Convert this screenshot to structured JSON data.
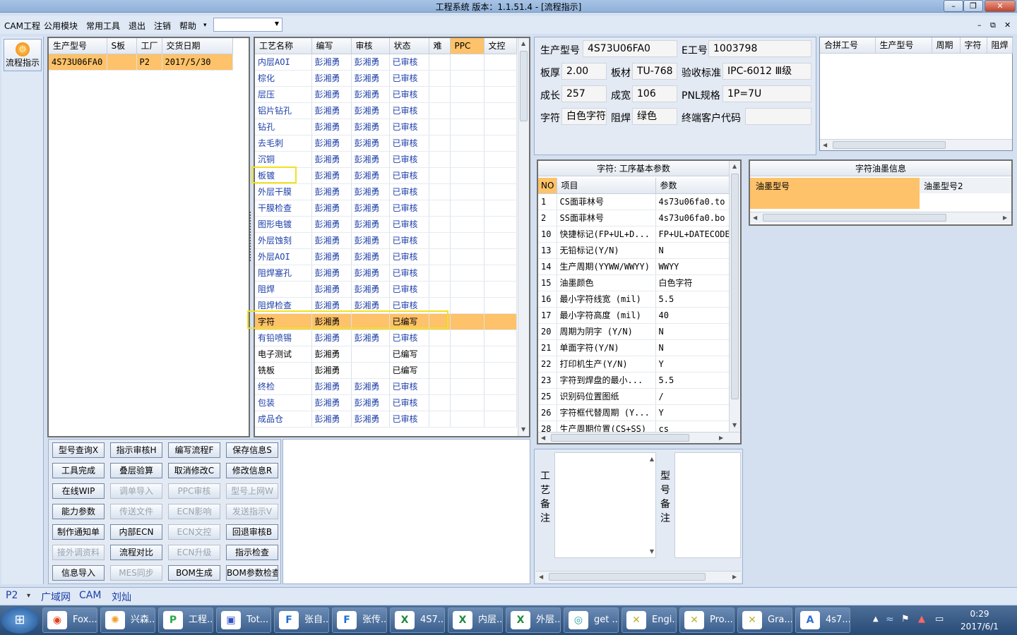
{
  "window": {
    "title": "工程系统   版本：1.1.51.4 - [流程指示]",
    "min": "–",
    "restore": "❐",
    "close": "✕"
  },
  "menu": {
    "items": [
      "CAM工程",
      "公用模块",
      "常用工具",
      "退出",
      "注销",
      "帮助"
    ],
    "help_arrow": "▾",
    "combo_value": "",
    "combo_arrow": "▼",
    "mdi_min": "–",
    "mdi_restore": "⧉",
    "mdi_close": "✕"
  },
  "sidebar": {
    "flow_button": "流程指示",
    "flow_icon": "power-icon"
  },
  "orders": {
    "columns": [
      "生产型号",
      "S板",
      "工厂",
      "交货日期"
    ],
    "rows": [
      {
        "model": "4S73U06FA0",
        "s": "",
        "factory": "P2",
        "date": "2017/5/30"
      }
    ]
  },
  "process": {
    "columns": [
      "工艺名称",
      "编写",
      "审核",
      "状态",
      "难",
      "PPC",
      "文控"
    ],
    "rows": [
      {
        "name": "内层AOI",
        "writer": "彭湘勇",
        "reviewer": "彭湘勇",
        "status": "已审核"
      },
      {
        "name": "棕化",
        "writer": "彭湘勇",
        "reviewer": "彭湘勇",
        "status": "已审核"
      },
      {
        "name": "层压",
        "writer": "彭湘勇",
        "reviewer": "彭湘勇",
        "status": "已审核"
      },
      {
        "name": "铝片钻孔",
        "writer": "彭湘勇",
        "reviewer": "彭湘勇",
        "status": "已审核"
      },
      {
        "name": "钻孔",
        "writer": "彭湘勇",
        "reviewer": "彭湘勇",
        "status": "已审核"
      },
      {
        "name": "去毛刺",
        "writer": "彭湘勇",
        "reviewer": "彭湘勇",
        "status": "已审核"
      },
      {
        "name": "沉铜",
        "writer": "彭湘勇",
        "reviewer": "彭湘勇",
        "status": "已审核"
      },
      {
        "name": "板镀",
        "writer": "彭湘勇",
        "reviewer": "彭湘勇",
        "status": "已审核"
      },
      {
        "name": "外层干膜",
        "writer": "彭湘勇",
        "reviewer": "彭湘勇",
        "status": "已审核"
      },
      {
        "name": "干膜检查",
        "writer": "彭湘勇",
        "reviewer": "彭湘勇",
        "status": "已审核"
      },
      {
        "name": "图形电镀",
        "writer": "彭湘勇",
        "reviewer": "彭湘勇",
        "status": "已审核"
      },
      {
        "name": "外层蚀刻",
        "writer": "彭湘勇",
        "reviewer": "彭湘勇",
        "status": "已审核"
      },
      {
        "name": "外层AOI",
        "writer": "彭湘勇",
        "reviewer": "彭湘勇",
        "status": "已审核"
      },
      {
        "name": "阻焊塞孔",
        "writer": "彭湘勇",
        "reviewer": "彭湘勇",
        "status": "已审核"
      },
      {
        "name": "阻焊",
        "writer": "彭湘勇",
        "reviewer": "彭湘勇",
        "status": "已审核"
      },
      {
        "name": "阻焊检查",
        "writer": "彭湘勇",
        "reviewer": "彭湘勇",
        "status": "已审核"
      },
      {
        "name": "字符",
        "writer": "彭湘勇",
        "reviewer": "",
        "status": "已编写"
      },
      {
        "name": "有铅喷锡",
        "writer": "彭湘勇",
        "reviewer": "彭湘勇",
        "status": "已审核"
      },
      {
        "name": "电子测试",
        "writer": "彭湘勇",
        "reviewer": "",
        "status": "已编写"
      },
      {
        "name": "铣板",
        "writer": "彭湘勇",
        "reviewer": "",
        "status": "已编写"
      },
      {
        "name": "终检",
        "writer": "彭湘勇",
        "reviewer": "彭湘勇",
        "status": "已审核"
      },
      {
        "name": "包装",
        "writer": "彭湘勇",
        "reviewer": "彭湘勇",
        "status": "已审核"
      },
      {
        "name": "成品仓",
        "writer": "彭湘勇",
        "reviewer": "彭湘勇",
        "status": "已审核"
      }
    ]
  },
  "buttons": [
    [
      "型号查询X",
      "指示审核H",
      "编写流程F",
      "保存信息S"
    ],
    [
      "工具完成",
      "叠层验算",
      "取消修改C",
      "修改信息R"
    ],
    [
      "在线WIP",
      "调单导入",
      "PPC审核",
      "型号上网W"
    ],
    [
      "能力参数",
      "传送文件",
      "ECN影响",
      "发送指示V"
    ],
    [
      "制作通知单",
      "内部ECN",
      "ECN文控",
      "回退审核B"
    ],
    [
      "接外调资料",
      "流程对比",
      "ECN升级",
      "指示检查"
    ],
    [
      "信息导入",
      "MES同步",
      "BOM生成",
      "BOM参数检查"
    ]
  ],
  "buttons_disabled": [
    [],
    [],
    [
      1,
      2,
      3
    ],
    [
      1,
      2,
      3
    ],
    [
      2
    ],
    [
      0,
      2
    ],
    [
      1
    ]
  ],
  "info": {
    "model_label": "生产型号",
    "model": "4S73U06FA0",
    "eno_label": "E工号",
    "eno": "1003798",
    "thick_label": "板厚",
    "thick": "2.00",
    "material_label": "板材",
    "material": "TU-768",
    "std_label": "验收标准",
    "std": "IPC-6012 Ⅲ级",
    "cl_label": "成长",
    "cl": "257",
    "cw_label": "成宽",
    "cw": "106",
    "pnl_label": "PNL规格",
    "pnl": "1P=7U",
    "char_label": "字符",
    "char": "白色字符",
    "mask_label": "阻焊",
    "mask": "绿色",
    "cust_label": "终端客户代码",
    "cust": ""
  },
  "combine": {
    "columns": [
      "合拼工号",
      "生产型号",
      "周期",
      "字符",
      "阻焊"
    ]
  },
  "params": {
    "title": "字符: 工序基本参数",
    "columns": [
      "NO",
      "项目",
      "参数"
    ],
    "rows": [
      {
        "no": "1",
        "item": "CS面菲林号",
        "val": "4s73u06fa0.to"
      },
      {
        "no": "2",
        "item": "SS面菲林号",
        "val": "4s73u06fa0.bo"
      },
      {
        "no": "10",
        "item": "快捷标记(FP+UL+D...",
        "val": "FP+UL+DATECODE"
      },
      {
        "no": "13",
        "item": "无铅标记(Y/N)",
        "val": "N"
      },
      {
        "no": "14",
        "item": "生产周期(YYWW/WWYY)",
        "val": "WWYY"
      },
      {
        "no": "15",
        "item": "油墨颜色",
        "val": "白色字符"
      },
      {
        "no": "16",
        "item": "最小字符线宽 (mil)",
        "val": "5.5"
      },
      {
        "no": "17",
        "item": "最小字符高度 (mil)",
        "val": "40"
      },
      {
        "no": "20",
        "item": "周期为阴字 (Y/N)",
        "val": "N"
      },
      {
        "no": "21",
        "item": "单面字符(Y/N)",
        "val": "N"
      },
      {
        "no": "22",
        "item": "打印机生产(Y/N)",
        "val": "Y"
      },
      {
        "no": "23",
        "item": "字符到焊盘的最小...",
        "val": "5.5"
      },
      {
        "no": "25",
        "item": "识别码位置图纸",
        "val": "/"
      },
      {
        "no": "26",
        "item": "字符框代替周期 (Y...",
        "val": "Y"
      },
      {
        "no": "28",
        "item": "生产周期位置(CS+SS)",
        "val": "cs"
      }
    ]
  },
  "ink": {
    "title": "字符油墨信息",
    "col1": "油墨型号",
    "col2": "油墨型号2"
  },
  "remarks": {
    "process_label": "工艺备注",
    "model_label": "型号备注"
  },
  "statusbar": {
    "factory": "P2",
    "arrow": "▾",
    "items": [
      "广域网",
      "CAM",
      "刘灿"
    ]
  },
  "taskbar": {
    "tasks": [
      {
        "label": "Fox...",
        "icon": "browser-icon"
      },
      {
        "label": "兴森...",
        "icon": "shell-icon"
      },
      {
        "label": "工程...",
        "icon": "p-app-icon"
      },
      {
        "label": "Tot...",
        "icon": "save-icon"
      },
      {
        "label": "张自...",
        "icon": "f-app-icon"
      },
      {
        "label": "张传...",
        "icon": "f-app-icon"
      },
      {
        "label": "4S7...",
        "icon": "excel-icon"
      },
      {
        "label": "内层...",
        "icon": "excel-icon"
      },
      {
        "label": "外层...",
        "icon": "excel-icon"
      },
      {
        "label": "get ...",
        "icon": "eye-icon"
      },
      {
        "label": "Engi...",
        "icon": "x-icon"
      },
      {
        "label": "Pro...",
        "icon": "x-icon"
      },
      {
        "label": "Gra...",
        "icon": "x-icon"
      },
      {
        "label": "4s7...",
        "icon": "doc-icon"
      }
    ],
    "time": "0:29",
    "date": "2017/6/1"
  }
}
